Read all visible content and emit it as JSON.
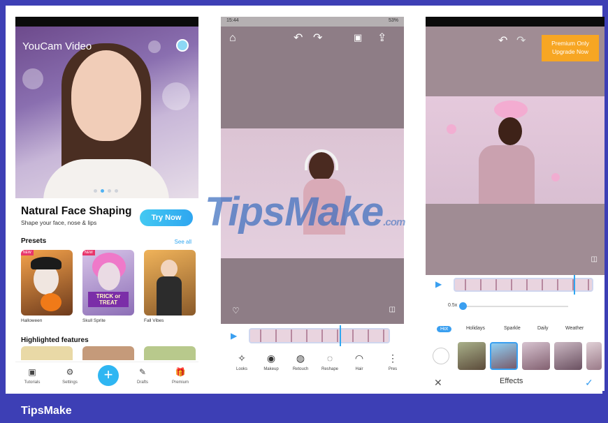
{
  "phone1": {
    "logo": "YouCam Video",
    "hero_title": "Natural Face Shaping",
    "hero_subtitle": "Shape your face, nose & lips",
    "try_now": "Try Now",
    "presets_title": "Presets",
    "see_all": "See all",
    "presets": [
      "Halloween",
      "Skull Sprite",
      "Fall Vibes"
    ],
    "preset_badge": "TRICK or TREAT",
    "highlighted_title": "Highlighted features",
    "tabs": [
      "Tutorials",
      "Settings",
      "Drafts",
      "Premium"
    ]
  },
  "phone2": {
    "time": "15:44",
    "status_right": "53%",
    "tools": [
      "Looks",
      "Makeup",
      "Retouch",
      "Reshape",
      "Hair",
      "Pres"
    ]
  },
  "phone3": {
    "premium_line1": "Premium Only",
    "premium_line2": "Upgrade Now",
    "speed": "0.5x",
    "categories": [
      "Hot",
      "Holidays",
      "Sparkle",
      "Daily",
      "Weather"
    ],
    "footer_title": "Effects"
  },
  "watermark": "TipsMake",
  "watermark_suffix": ".com",
  "brand": "TipsMake"
}
